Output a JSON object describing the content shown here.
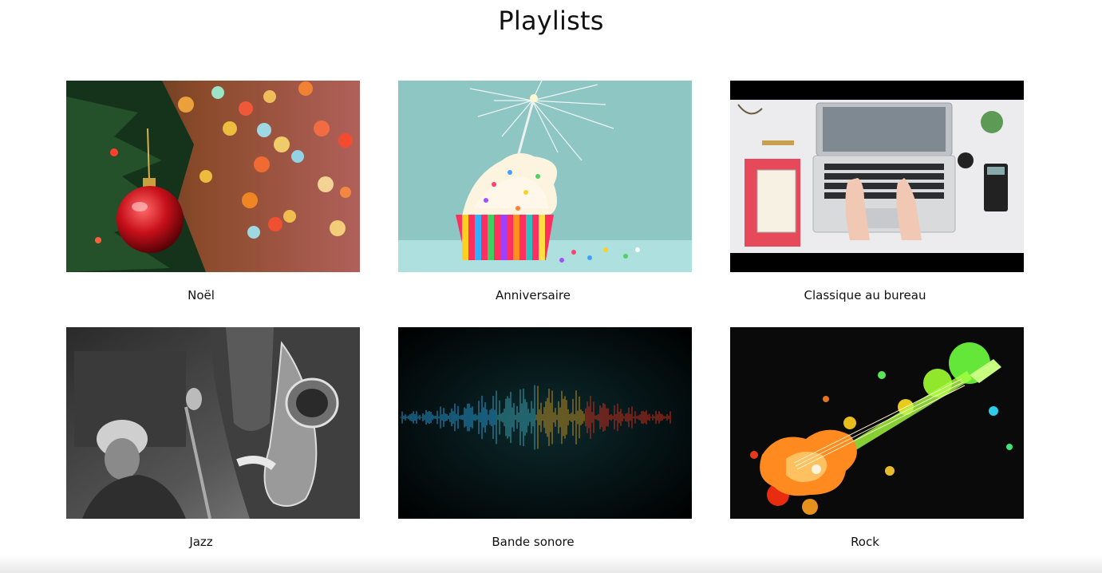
{
  "page": {
    "title": "Playlists"
  },
  "playlists": [
    {
      "label": "Noël",
      "image": "christmas-ornament-bokeh-image"
    },
    {
      "label": "Anniversaire",
      "image": "birthday-cupcake-sparkler-image"
    },
    {
      "label": "Classique au bureau",
      "image": "laptop-desk-typing-image"
    },
    {
      "label": "Jazz",
      "image": "jazz-saxophone-bw-image"
    },
    {
      "label": "Bande sonore",
      "image": "soundwave-spectrum-image"
    },
    {
      "label": "Rock",
      "image": "paint-splash-guitar-image"
    }
  ]
}
